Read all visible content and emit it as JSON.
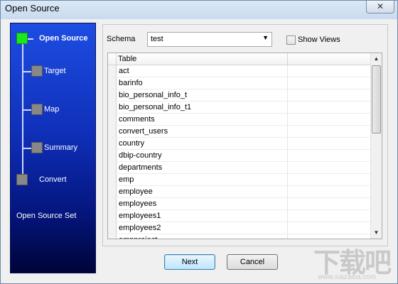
{
  "window": {
    "title": "Open Source",
    "close_glyph": "✕"
  },
  "wizard": {
    "steps": [
      {
        "label": "Open Source",
        "state": "active"
      },
      {
        "label": "Target",
        "state": "pending"
      },
      {
        "label": "Map",
        "state": "pending"
      },
      {
        "label": "Summary",
        "state": "pending"
      },
      {
        "label": "Convert",
        "state": "pending"
      }
    ],
    "set_label": "Open Source Set",
    "colors": {
      "active": "#1ee61e",
      "pending": "#888888",
      "panel_top": "#1d4de2",
      "panel_bottom": "#000438"
    }
  },
  "schema": {
    "label": "Schema",
    "value": "test",
    "arrow_icon": "chevron-down-icon"
  },
  "show_views": {
    "label": "Show Views",
    "checked": false
  },
  "table": {
    "column": "Table",
    "rows": [
      "act",
      "barinfo",
      "bio_personal_info_t",
      "bio_personal_info_t1",
      "comments",
      "convert_users",
      "country",
      "dbip-country",
      "departments",
      "emp",
      "employee",
      "employees",
      "employees1",
      "employees2",
      "empproject"
    ]
  },
  "buttons": {
    "next": "Next",
    "cancel": "Cancel"
  },
  "watermark": {
    "top": "下载吧",
    "bottom": "www.xiazaiba.com"
  }
}
